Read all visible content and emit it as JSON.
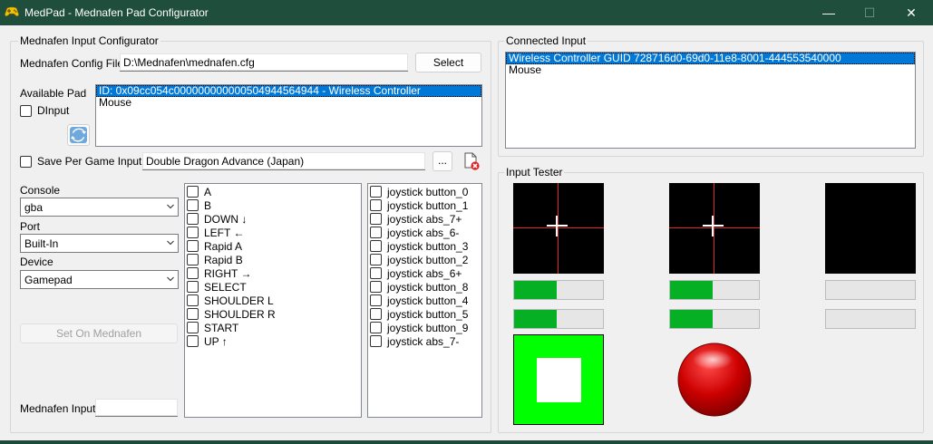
{
  "window": {
    "title": "MedPad - Mednafen Pad Configurator",
    "minimize": "—",
    "maximize": "☐",
    "close": "✕"
  },
  "configurator": {
    "group_title": "Mednafen Input Configurator",
    "config_file_label": "Mednafen Config File",
    "config_file_value": "D:\\Mednafen\\mednafen.cfg",
    "select_button": "Select",
    "available_pad_label": "Available Pad",
    "dinput_label": "DInput",
    "available_pads": [
      "ID: 0x09cc054c000000000000504944564944 - Wireless Controller",
      "Mouse"
    ],
    "save_per_game_label": "Save Per Game Input",
    "game_value": "Double Dragon Advance (Japan)",
    "browse_button": "...",
    "console_label": "Console",
    "console_value": "gba",
    "port_label": "Port",
    "port_value": "Built-In",
    "device_label": "Device",
    "device_value": "Gamepad",
    "set_button": "Set On Mednafen",
    "mednafen_input_label": "Mednafen Input",
    "mednafen_input_value": "",
    "buttons": [
      "A",
      "B",
      "DOWN ↓",
      "LEFT ←",
      "Rapid A",
      "Rapid B",
      "RIGHT →",
      "SELECT",
      "SHOULDER L",
      "SHOULDER R",
      "START",
      "UP ↑"
    ],
    "mappings": [
      "joystick button_0",
      "joystick button_1",
      "joystick abs_7+",
      "joystick abs_6-",
      "joystick button_3",
      "joystick button_2",
      "joystick abs_6+",
      "joystick button_8",
      "joystick button_4",
      "joystick button_5",
      "joystick button_9",
      "joystick abs_7-"
    ]
  },
  "connected": {
    "group_title": "Connected Input",
    "items": [
      "Wireless Controller GUID 728716d0-69d0-11e8-8001-444553540000",
      "Mouse"
    ]
  },
  "tester": {
    "group_title": "Input Tester",
    "bars": [
      {
        "value": 0.48
      },
      {
        "value": 0.48
      },
      {
        "value": 0.0
      },
      {
        "value": 0.48
      },
      {
        "value": 0.48
      },
      {
        "value": 0.0
      }
    ]
  },
  "colors": {
    "titlebar": "#1f4e3d",
    "selection": "#0078d7",
    "progress_fill": "#06b025",
    "crosshair": "#e3272b",
    "indicator_green": "#00ff00",
    "indicator_red": "#c00000"
  }
}
